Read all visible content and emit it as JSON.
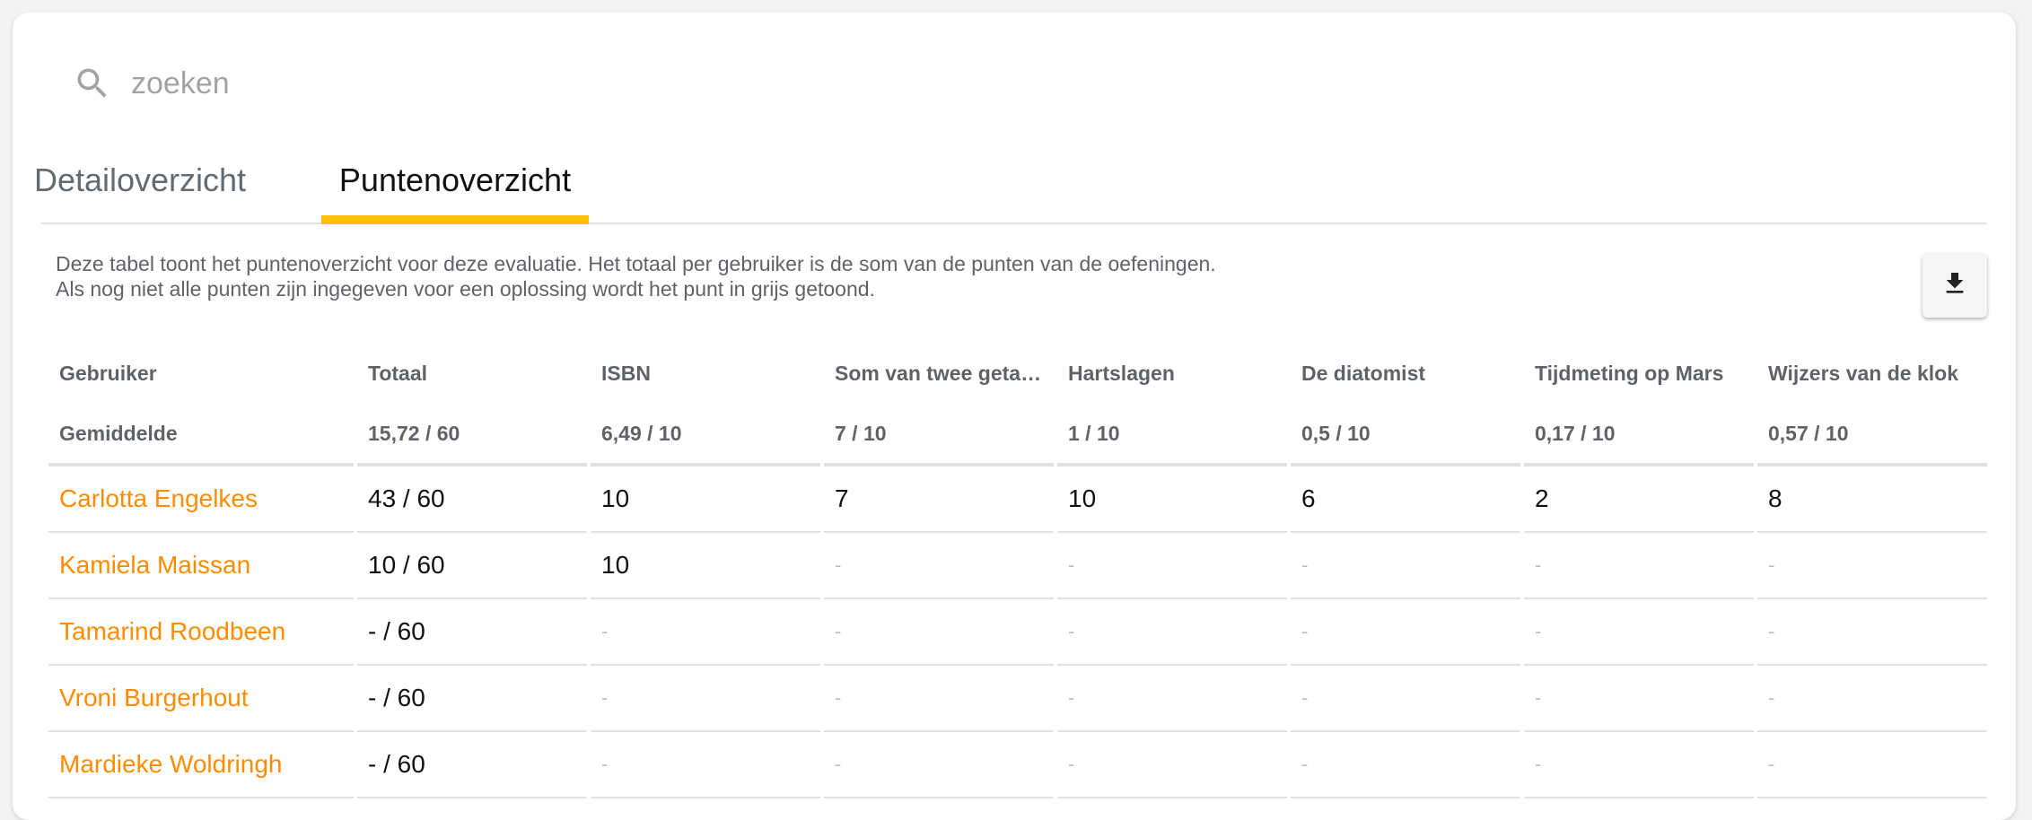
{
  "search": {
    "placeholder": "zoeken"
  },
  "tabs": [
    {
      "label": "Detailoverzicht",
      "active": false
    },
    {
      "label": "Puntenoverzicht",
      "active": true
    }
  ],
  "description": {
    "line1": "Deze tabel toont het puntenoverzicht voor deze evaluatie. Het totaal per gebruiker is de som van de punten van de oefeningen.",
    "line2": "Als nog niet alle punten zijn ingegeven voor een oplossing wordt het punt in grijs getoond."
  },
  "download": {
    "icon": "download-icon"
  },
  "table": {
    "headers": [
      "Gebruiker",
      "Totaal",
      "ISBN",
      "Som van twee geta…",
      "Hartslagen",
      "De diatomist",
      "Tijdmeting op Mars",
      "Wijzers van de klok"
    ],
    "average": [
      "Gemiddelde",
      "15,72 / 60",
      "6,49 / 10",
      "7 / 10",
      "1 / 10",
      "0,5 / 10",
      "0,17 / 10",
      "0,57 / 10"
    ],
    "rows": [
      [
        "Carlotta Engelkes",
        "43 / 60",
        "10",
        "7",
        "10",
        "6",
        "2",
        "8"
      ],
      [
        "Kamiela Maissan",
        "10 / 60",
        "10",
        "-",
        "-",
        "-",
        "-",
        "-"
      ],
      [
        "Tamarind Roodbeen",
        "- / 60",
        "-",
        "-",
        "-",
        "-",
        "-",
        "-"
      ],
      [
        "Vroni Burgerhout",
        "- / 60",
        "-",
        "-",
        "-",
        "-",
        "-",
        "-"
      ],
      [
        "Mardieke Woldringh",
        "- / 60",
        "-",
        "-",
        "-",
        "-",
        "-",
        "-"
      ]
    ]
  },
  "colors": {
    "accent": "#ffc107",
    "user_link": "#ff8c00",
    "muted": "#5f6368"
  }
}
